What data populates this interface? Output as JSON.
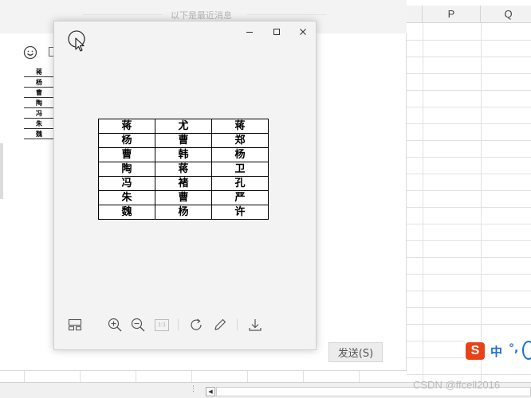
{
  "spreadsheet": {
    "columns": [
      {
        "label": "P"
      },
      {
        "label": "Q"
      }
    ]
  },
  "chat": {
    "recent_messages_label": "以下是最近消息",
    "thumbnail_rows": [
      "蒋",
      "杨",
      "曹",
      "陶",
      "冯",
      "朱",
      "魏"
    ],
    "send_button_label": "发送(S)"
  },
  "viewer": {
    "window_controls": {
      "minimize": "minimize-icon",
      "maximize": "maximize-icon",
      "close": "close-icon"
    },
    "table_rows": [
      [
        "蒋",
        "尤",
        "蒋"
      ],
      [
        "杨",
        "曹",
        "郑"
      ],
      [
        "曹",
        "韩",
        "杨"
      ],
      [
        "陶",
        "蒋",
        "卫"
      ],
      [
        "冯",
        "褚",
        "孔"
      ],
      [
        "朱",
        "曹",
        "严"
      ],
      [
        "魏",
        "杨",
        "许"
      ]
    ],
    "toolbar": [
      {
        "name": "thumbnails-icon"
      },
      {
        "name": "zoom-in-icon"
      },
      {
        "name": "zoom-out-icon"
      },
      {
        "name": "actual-size-icon",
        "label": "1:1"
      },
      {
        "name": "rotate-icon"
      },
      {
        "name": "edit-pen-icon"
      },
      {
        "name": "download-icon"
      }
    ]
  },
  "ime": {
    "logo": "S",
    "mode": "中",
    "punctuation": "°,"
  },
  "watermark": "CSDN @ffcell2016",
  "colors": {
    "ime_accent": "#1d6fd6",
    "ime_logo_bg": "#e8421b"
  }
}
